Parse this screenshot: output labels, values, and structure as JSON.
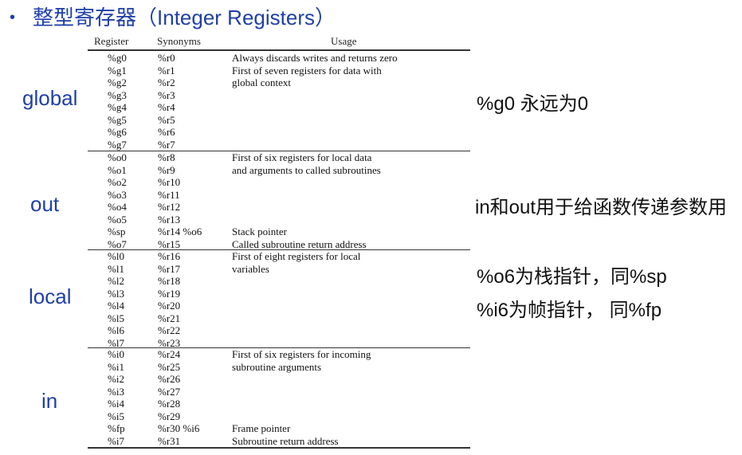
{
  "title": {
    "bullet": "•",
    "text": "整型寄存器（Integer Registers）"
  },
  "table": {
    "headers": {
      "register": "Register",
      "synonyms": "Synonyms",
      "usage": "Usage"
    },
    "groups": [
      {
        "label": "global",
        "rows": [
          {
            "reg": "%g0",
            "syn": "%r0",
            "usage": "Always discards writes and returns zero"
          },
          {
            "reg": "%g1",
            "syn": "%r1",
            "usage": "First of seven registers for data with"
          },
          {
            "reg": "%g2",
            "syn": "%r2",
            "usage": "global context"
          },
          {
            "reg": "%g3",
            "syn": "%r3",
            "usage": ""
          },
          {
            "reg": "%g4",
            "syn": "%r4",
            "usage": ""
          },
          {
            "reg": "%g5",
            "syn": "%r5",
            "usage": ""
          },
          {
            "reg": "%g6",
            "syn": "%r6",
            "usage": ""
          },
          {
            "reg": "%g7",
            "syn": "%r7",
            "usage": ""
          }
        ]
      },
      {
        "label": "out",
        "rows": [
          {
            "reg": "%o0",
            "syn": "%r8",
            "usage": "First of six registers for local data"
          },
          {
            "reg": "%o1",
            "syn": "%r9",
            "usage": "and arguments to called subroutines"
          },
          {
            "reg": "%o2",
            "syn": "%r10",
            "usage": ""
          },
          {
            "reg": "%o3",
            "syn": "%r11",
            "usage": ""
          },
          {
            "reg": "%o4",
            "syn": "%r12",
            "usage": ""
          },
          {
            "reg": "%o5",
            "syn": "%r13",
            "usage": ""
          },
          {
            "reg": "%sp",
            "syn": "%r14 %o6",
            "usage": "Stack pointer"
          },
          {
            "reg": "%o7",
            "syn": "%r15",
            "usage": "Called subroutine return address"
          }
        ]
      },
      {
        "label": "local",
        "rows": [
          {
            "reg": "%l0",
            "syn": "%r16",
            "usage": "First of eight registers for local"
          },
          {
            "reg": "%l1",
            "syn": "%r17",
            "usage": "variables"
          },
          {
            "reg": "%l2",
            "syn": "%r18",
            "usage": ""
          },
          {
            "reg": "%l3",
            "syn": "%r19",
            "usage": ""
          },
          {
            "reg": "%l4",
            "syn": "%r20",
            "usage": ""
          },
          {
            "reg": "%l5",
            "syn": "%r21",
            "usage": ""
          },
          {
            "reg": "%l6",
            "syn": "%r22",
            "usage": ""
          },
          {
            "reg": "%l7",
            "syn": "%r23",
            "usage": ""
          }
        ]
      },
      {
        "label": "in",
        "rows": [
          {
            "reg": "%i0",
            "syn": "%r24",
            "usage": "First of six registers for incoming"
          },
          {
            "reg": "%i1",
            "syn": "%r25",
            "usage": "subroutine arguments"
          },
          {
            "reg": "%i2",
            "syn": "%r26",
            "usage": ""
          },
          {
            "reg": "%i3",
            "syn": "%r27",
            "usage": ""
          },
          {
            "reg": "%i4",
            "syn": "%r28",
            "usage": ""
          },
          {
            "reg": "%i5",
            "syn": "%r29",
            "usage": ""
          },
          {
            "reg": "%fp",
            "syn": "%r30 %i6",
            "usage": "Frame pointer"
          },
          {
            "reg": "%i7",
            "syn": "%r31",
            "usage": "Subroutine return address"
          }
        ]
      }
    ]
  },
  "notes": [
    "%g0 永远为0",
    "in和out用于给函数传递参数用",
    "%o6为栈指针，同%sp",
    "%i6为帧指针， 同%fp"
  ],
  "colors": {
    "title": "#1f3fa8",
    "group_label": "#1f3fa8",
    "note": "#111111",
    "table_text": "#111111"
  }
}
